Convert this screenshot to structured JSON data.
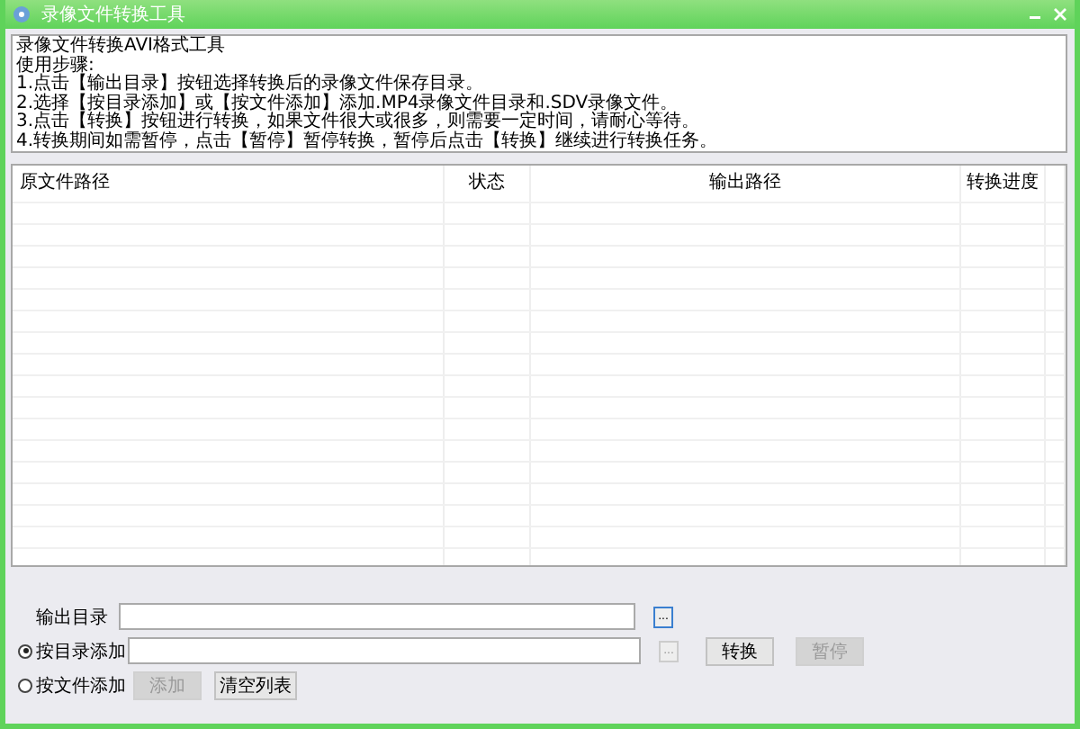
{
  "window": {
    "title": "录像文件转换工具"
  },
  "info_text": {
    "lines": [
      "录像文件转换AVI格式工具",
      "使用步骤:",
      "1.点击【输出目录】按钮选择转换后的录像文件保存目录。",
      "2.选择【按目录添加】或【按文件添加】添加.MP4录像文件目录和.SDV录像文件。",
      "3.点击【转换】按钮进行转换，如果文件很大或很多，则需要一定时间，请耐心等待。",
      "4.转换期间如需暂停，点击【暂停】暂停转换，暂停后点击【转换】继续进行转换任务。"
    ]
  },
  "table": {
    "columns": [
      "原文件路径",
      "状态",
      "输出路径",
      "转换进度"
    ]
  },
  "output_dir": {
    "label": "输出目录",
    "browse": "..."
  },
  "add_mode": [
    {
      "label": "按目录添加",
      "selected": true,
      "browse": "...",
      "browse_disabled": true
    },
    {
      "label": "按文件添加",
      "selected": false
    }
  ],
  "buttons": [
    {
      "label": "转换",
      "disabled": false
    },
    {
      "label": "暂停",
      "disabled": true
    },
    {
      "label": "添加",
      "disabled": true
    },
    {
      "label": "清空列表",
      "disabled": false
    }
  ]
}
